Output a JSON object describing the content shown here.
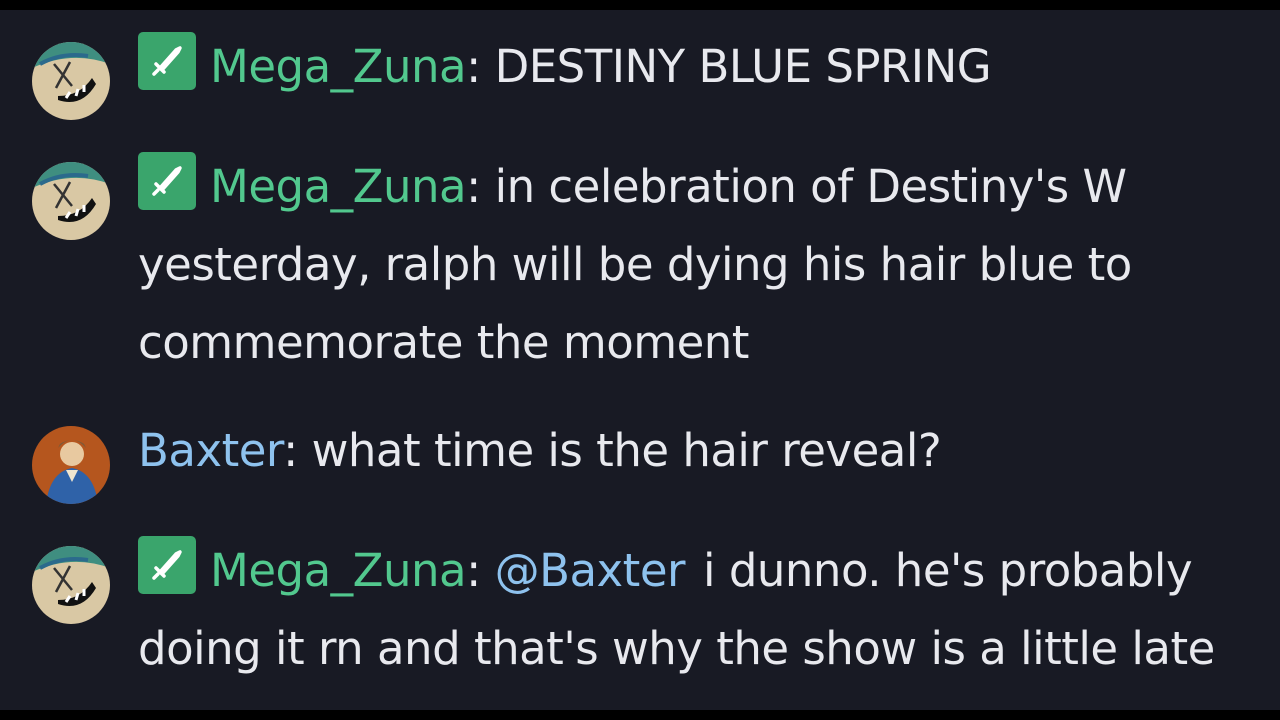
{
  "messages": [
    {
      "username": "Mega_Zuna",
      "text": "DESTINY BLUE SPRING",
      "avatar_icon": "grinning-face-avatar",
      "badge_icon": "sword-moderator-icon"
    },
    {
      "username": "Mega_Zuna",
      "text": "in celebration of Destiny's W yesterday, ralph will be dying his hair blue to commemorate the moment",
      "avatar_icon": "grinning-face-avatar",
      "badge_icon": "sword-moderator-icon"
    },
    {
      "username": "Baxter",
      "text": "what time is the hair reveal?",
      "avatar_icon": "medieval-portrait-avatar"
    },
    {
      "username": "Mega_Zuna",
      "mention": "@Baxter",
      "text": "i dunno. he's probably doing it rn and that's why the show is a little late",
      "avatar_icon": "grinning-face-avatar",
      "badge_icon": "sword-moderator-icon"
    }
  ],
  "separator": ":",
  "colors": {
    "background": "#181a24",
    "moderator_name": "#52c88e",
    "user_name": "#8ec2ee",
    "badge": "#3aa56c",
    "message_text": "#e8e9ee"
  }
}
